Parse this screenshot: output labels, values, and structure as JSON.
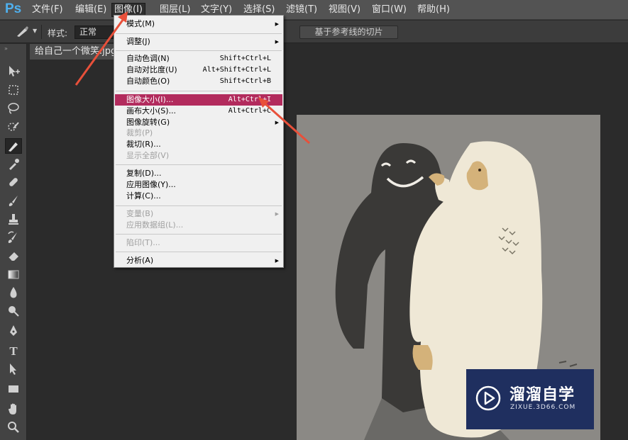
{
  "app": {
    "logo": "Ps"
  },
  "menubar": {
    "items": [
      "文件(F)",
      "编辑(E)",
      "图像(I)",
      "图层(L)",
      "文字(Y)",
      "选择(S)",
      "滤镜(T)",
      "视图(V)",
      "窗口(W)",
      "帮助(H)"
    ],
    "active": "图像(I)"
  },
  "options": {
    "style_label": "样式:",
    "style_value": "正常",
    "slice_button": "基于参考线的切片"
  },
  "document": {
    "tab_title": "给自己一个微笑.jpg"
  },
  "toolbar": {
    "tools": [
      "move-tool",
      "marquee-tool",
      "lasso-tool",
      "quick-select-tool",
      "slice-tool",
      "eyedropper-tool",
      "healing-brush-tool",
      "brush-tool",
      "clone-stamp-tool",
      "history-brush-tool",
      "eraser-tool",
      "gradient-tool",
      "blur-tool",
      "dodge-tool",
      "pen-tool",
      "type-tool",
      "path-select-tool",
      "rectangle-tool",
      "hand-tool",
      "zoom-tool"
    ],
    "selected": "slice-tool"
  },
  "image_menu": {
    "items": [
      {
        "label": "模式(M)",
        "shortcut": "",
        "submenu": true,
        "disabled": false
      },
      {
        "label": "调整(J)",
        "shortcut": "",
        "submenu": true,
        "disabled": false
      },
      {
        "label": "自动色调(N)",
        "shortcut": "Shift+Ctrl+L",
        "submenu": false,
        "disabled": false
      },
      {
        "label": "自动对比度(U)",
        "shortcut": "Alt+Shift+Ctrl+L",
        "submenu": false,
        "disabled": false
      },
      {
        "label": "自动颜色(O)",
        "shortcut": "Shift+Ctrl+B",
        "submenu": false,
        "disabled": false
      },
      {
        "label": "图像大小(I)...",
        "shortcut": "Alt+Ctrl+I",
        "submenu": false,
        "disabled": false,
        "highlighted": true
      },
      {
        "label": "画布大小(S)...",
        "shortcut": "Alt+Ctrl+C",
        "submenu": false,
        "disabled": false
      },
      {
        "label": "图像旋转(G)",
        "shortcut": "",
        "submenu": true,
        "disabled": false
      },
      {
        "label": "裁剪(P)",
        "shortcut": "",
        "submenu": false,
        "disabled": true
      },
      {
        "label": "裁切(R)...",
        "shortcut": "",
        "submenu": false,
        "disabled": false
      },
      {
        "label": "显示全部(V)",
        "shortcut": "",
        "submenu": false,
        "disabled": true
      },
      {
        "label": "复制(D)...",
        "shortcut": "",
        "submenu": false,
        "disabled": false
      },
      {
        "label": "应用图像(Y)...",
        "shortcut": "",
        "submenu": false,
        "disabled": false
      },
      {
        "label": "计算(C)...",
        "shortcut": "",
        "submenu": false,
        "disabled": false
      },
      {
        "label": "变量(B)",
        "shortcut": "",
        "submenu": true,
        "disabled": true
      },
      {
        "label": "应用数据组(L)...",
        "shortcut": "",
        "submenu": false,
        "disabled": true
      },
      {
        "label": "陷印(T)...",
        "shortcut": "",
        "submenu": false,
        "disabled": true
      },
      {
        "label": "分析(A)",
        "shortcut": "",
        "submenu": true,
        "disabled": false
      }
    ]
  },
  "watermark": {
    "title": "溜溜自学",
    "url": "ZIXUE.3D66.COM"
  },
  "colors": {
    "menu_highlight": "#b22b5d",
    "arrow": "#e8503a",
    "ps_blue": "#4fb0ee",
    "watermark_bg": "#1f2f5f"
  }
}
